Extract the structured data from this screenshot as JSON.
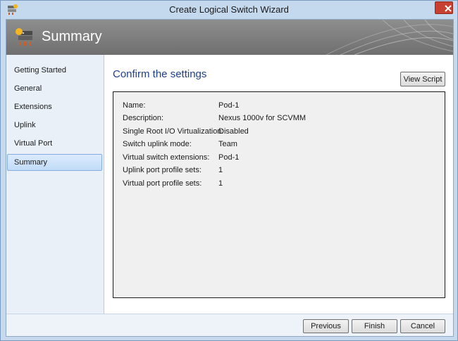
{
  "window": {
    "title": "Create Logical Switch Wizard",
    "icon": "switch-wizard-icon",
    "accent": "#c8402f"
  },
  "banner": {
    "title": "Summary",
    "icon": "logical-switch-icon"
  },
  "sidebar": {
    "items": [
      {
        "label": "Getting Started",
        "selected": false
      },
      {
        "label": "General",
        "selected": false
      },
      {
        "label": "Extensions",
        "selected": false
      },
      {
        "label": "Uplink",
        "selected": false
      },
      {
        "label": "Virtual Port",
        "selected": false
      },
      {
        "label": "Summary",
        "selected": true
      }
    ]
  },
  "main": {
    "heading": "Confirm the settings",
    "view_script_label": "View Script",
    "settings": [
      {
        "label": "Name:",
        "value": "Pod-1"
      },
      {
        "label": "Description:",
        "value": "Nexus 1000v for SCVMM"
      },
      {
        "label": "Single Root I/O Virtualization:",
        "value": "Disabled"
      },
      {
        "label": "Switch uplink mode:",
        "value": "Team"
      },
      {
        "label": "Virtual switch extensions:",
        "value": "Pod-1"
      },
      {
        "label": "Uplink port profile sets:",
        "value": "1"
      },
      {
        "label": "Virtual port profile sets:",
        "value": "1"
      }
    ]
  },
  "footer": {
    "previous_label": "Previous",
    "finish_label": "Finish",
    "cancel_label": "Cancel"
  }
}
